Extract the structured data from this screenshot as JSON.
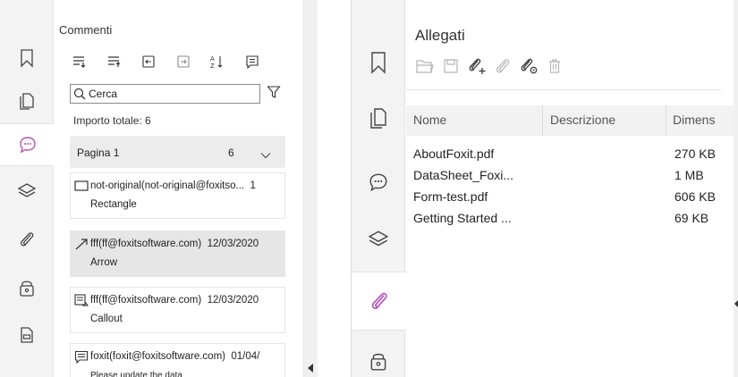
{
  "comments_panel": {
    "title": "Commenti",
    "search": {
      "value": "Cerca"
    },
    "total_text": "Importo totale: 6",
    "page_group": {
      "label": "Pagina 1",
      "count": "6"
    },
    "items": [
      {
        "author": "not-original(not-original@foxitso...",
        "date": "1",
        "type": "Rectangle"
      },
      {
        "author": "fff(ff@foxitsoftware.com)",
        "date": "12/03/2020",
        "type": "Arrow"
      },
      {
        "author": "fff(ff@foxitsoftware.com)",
        "date": "12/03/2020",
        "type": "Callout"
      },
      {
        "author": "foxit(foxit@foxitsoftware.com)",
        "date": "01/04/",
        "type": "Please update the data"
      }
    ]
  },
  "attachments_panel": {
    "title": "Allegati",
    "columns": [
      "Nome",
      "Descrizione",
      "Dimens"
    ],
    "rows": [
      {
        "name": "AboutFoxit.pdf",
        "size": "270 KB"
      },
      {
        "name": "DataSheet_Foxi...",
        "size": "1 MB"
      },
      {
        "name": "Form-test.pdf",
        "size": "606 KB"
      },
      {
        "name": "Getting Started ...",
        "size": "69 KB"
      }
    ]
  },
  "colors": {
    "accent": "#b44fc0",
    "selected_row": "#e6e6e6",
    "sidebar": "#f3f3f3"
  },
  "icons": {
    "sidebar": [
      "bookmark-icon",
      "pages-icon",
      "comments-icon",
      "layers-icon",
      "attachments-icon",
      "security-icon",
      "fields-icon"
    ],
    "comment_toolbar": [
      "expand-all-icon",
      "collapse-all-icon",
      "import-icon",
      "export-icon",
      "sort-icon",
      "summarize-icon"
    ],
    "attachment_toolbar": [
      "open-icon",
      "save-icon",
      "add-attachment-icon",
      "remove-attachment-icon",
      "attachment-settings-icon",
      "delete-icon"
    ]
  }
}
